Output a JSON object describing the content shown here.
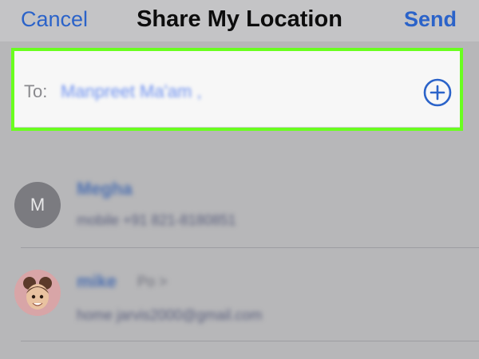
{
  "nav": {
    "cancel_label": "Cancel",
    "title": "Share My Location",
    "send_label": "Send"
  },
  "to_field": {
    "label": "To:",
    "recipient": "Manpreet Ma'am ,",
    "add_icon": "plus-circle-icon"
  },
  "contacts": [
    {
      "initial": "M",
      "name": "Megha",
      "detail": "mobile +91 821-8180851"
    },
    {
      "name": "mike",
      "extra": "Po >",
      "detail": "home jarvis2000@gmail.com",
      "avatar_icon": "memoji-avatar"
    }
  ],
  "colors": {
    "accent": "#2b63c9",
    "highlight_border": "#6aff1f",
    "background": "#b7b7b9"
  }
}
